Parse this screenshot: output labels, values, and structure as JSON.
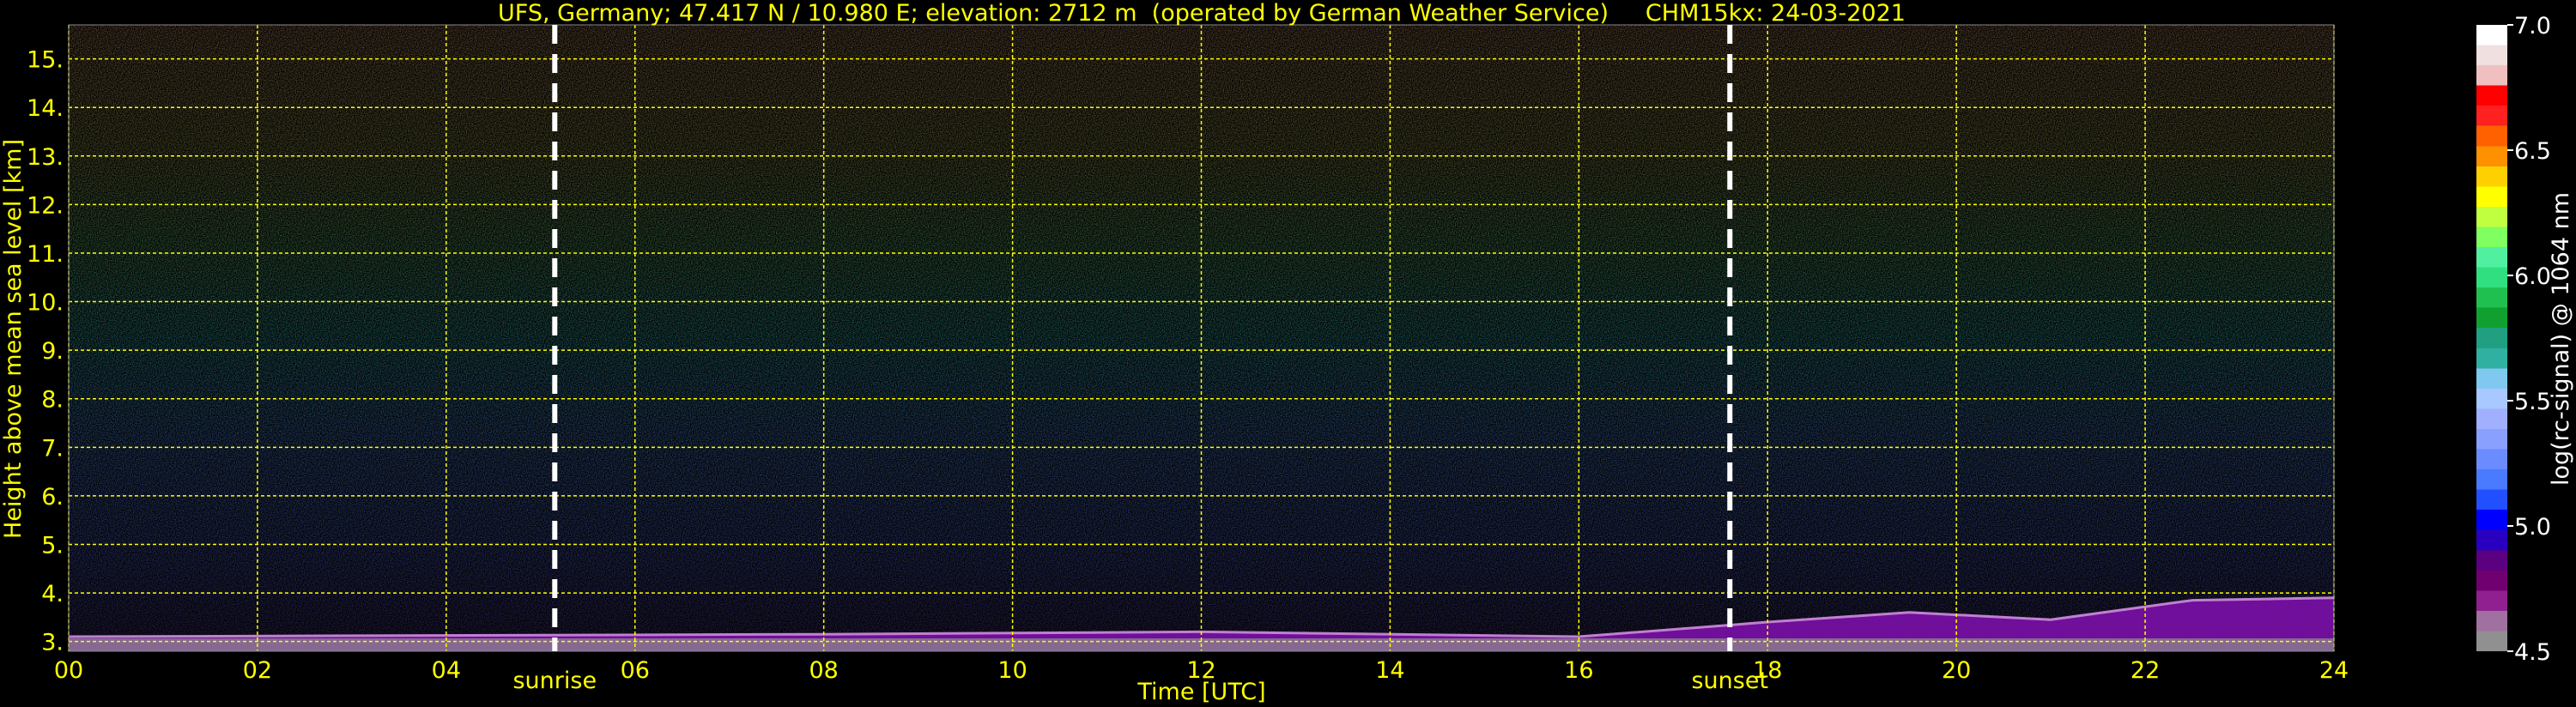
{
  "chart_data": {
    "type": "heatmap",
    "title": "UFS, Germany; 47.417 N / 10.980 E; elevation: 2712 m  (operated by German Weather Service)     CHM15kx: 24-03-2021",
    "xlabel": "Time [UTC]",
    "ylabel": "Height above mean sea level [km]",
    "xlim": [
      0,
      24
    ],
    "ylim": [
      2.8,
      15.7
    ],
    "x_ticks": [
      "00",
      "02",
      "04",
      "06",
      "08",
      "10",
      "12",
      "14",
      "16",
      "18",
      "20",
      "22",
      "24"
    ],
    "x_tick_values": [
      0,
      2,
      4,
      6,
      8,
      10,
      12,
      14,
      16,
      18,
      20,
      22,
      24
    ],
    "y_ticks": [
      "3.",
      "4.",
      "5.",
      "6.",
      "7.",
      "8.",
      "9.",
      "10.",
      "11.",
      "12.",
      "13.",
      "14.",
      "15."
    ],
    "y_tick_values": [
      3,
      4,
      5,
      6,
      7,
      8,
      9,
      10,
      11,
      12,
      13,
      14,
      15
    ],
    "grid": true,
    "grid_color": "#ffff00",
    "events": [
      {
        "label": "sunrise",
        "time": 5.15
      },
      {
        "label": "sunset",
        "time": 17.6
      }
    ],
    "colorbar": {
      "label": "log(rc-signal) @ 1064 nm",
      "min": 4.5,
      "max": 7.0,
      "ticks": [
        "7.0",
        "6.5",
        "6.0",
        "5.5",
        "5.0",
        "4.5"
      ],
      "tick_values": [
        7.0,
        6.5,
        6.0,
        5.5,
        5.0,
        4.5
      ],
      "colors": [
        "#909090",
        "#a070a0",
        "#902090",
        "#700070",
        "#5a0080",
        "#2a00c0",
        "#0000ff",
        "#2050ff",
        "#4a7aff",
        "#6a8cff",
        "#8aa0ff",
        "#a0b0ff",
        "#a8c8ff",
        "#80c8f0",
        "#30b0a0",
        "#20a080",
        "#10a030",
        "#20c050",
        "#30e080",
        "#50f0a0",
        "#80ff60",
        "#c0ff40",
        "#ffff00",
        "#ffd000",
        "#ff9000",
        "#ff6000",
        "#ff2020",
        "#ff0000",
        "#f0c0c0",
        "#f0e0e0",
        "#ffffff"
      ]
    },
    "signal_profile": [
      {
        "height_km": 3.0,
        "log_signal": 4.6
      },
      {
        "height_km": 5.0,
        "log_signal": 5.0
      },
      {
        "height_km": 7.0,
        "log_signal": 5.3
      },
      {
        "height_km": 9.0,
        "log_signal": 5.6
      },
      {
        "height_km": 11.0,
        "log_signal": 5.9
      },
      {
        "height_km": 13.0,
        "log_signal": 6.2
      },
      {
        "height_km": 15.0,
        "log_signal": 6.5
      }
    ],
    "boundary_layer_top": [
      {
        "time": 0,
        "height_km": 3.1
      },
      {
        "time": 8,
        "height_km": 3.15
      },
      {
        "time": 12,
        "height_km": 3.2
      },
      {
        "time": 16,
        "height_km": 3.1
      },
      {
        "time": 18,
        "height_km": 3.4
      },
      {
        "time": 19.5,
        "height_km": 3.6
      },
      {
        "time": 21,
        "height_km": 3.45
      },
      {
        "time": 22.5,
        "height_km": 3.85
      },
      {
        "time": 24,
        "height_km": 3.9
      }
    ]
  }
}
